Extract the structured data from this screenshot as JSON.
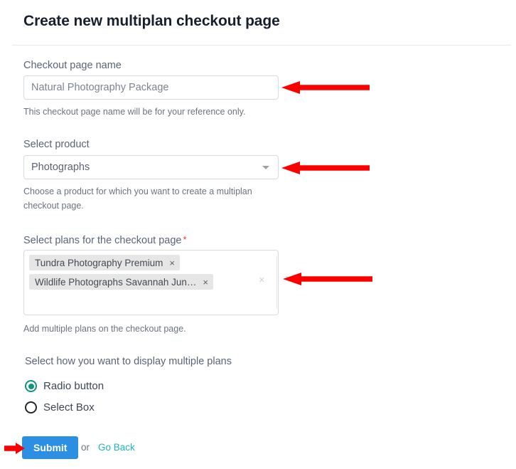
{
  "header": {
    "title": "Create new multiplan checkout page"
  },
  "form": {
    "checkout_name": {
      "label": "Checkout page name",
      "value": "Natural Photography Package",
      "placeholder": "Natural Photography Package",
      "help": "This checkout page name will be for your reference only."
    },
    "product": {
      "label": "Select product",
      "value": "Photographs",
      "help": "Choose a product for which you want to create a multiplan\ncheckout page.",
      "caret_icon": "chevron-down-icon"
    },
    "plans": {
      "label": "Select plans for the checkout page",
      "required_marker": "*",
      "help": "Add multiple plans on the checkout page.",
      "tags": [
        {
          "label": "Tundra Photography Premium",
          "remove_icon": "×"
        },
        {
          "label": "Wildlife Photographs Savannah Jun…",
          "remove_icon": "×"
        }
      ],
      "clear_icon": "×",
      "dropdown_icon": "chevron-down-icon"
    },
    "display_mode": {
      "label": "Select how you want to display multiple plans",
      "options": [
        {
          "label": "Radio button",
          "selected": true
        },
        {
          "label": "Select Box",
          "selected": false
        }
      ],
      "selected_color": "#13937f"
    }
  },
  "actions": {
    "submit_label": "Submit",
    "or_label": "or",
    "go_back_label": "Go Back",
    "submit_color": "#2d8fe3",
    "go_back_color": "#1fb4ba"
  },
  "annotations": {
    "color": "#fc0000",
    "arrows": [
      {
        "name": "arrow-to-checkout-name-input",
        "direction": "left"
      },
      {
        "name": "arrow-to-product-select",
        "direction": "left"
      },
      {
        "name": "arrow-to-plans-dropdown",
        "direction": "left"
      },
      {
        "name": "arrow-to-submit-button",
        "direction": "right"
      }
    ]
  }
}
